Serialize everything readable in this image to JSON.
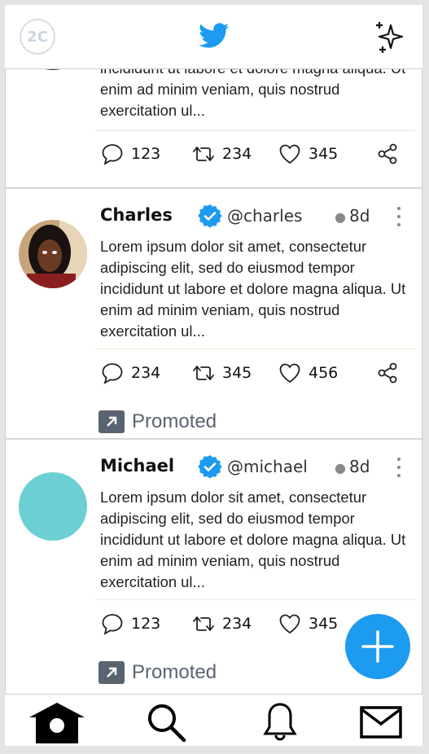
{
  "header": {
    "avatar_text": "2C",
    "logo_icon": "twitter-bird-icon",
    "sparkle_icon": "sparkle-icon"
  },
  "tweets": [
    {
      "body": "incididunt ut labore et dolore magna aliqua. Ut enim ad minim veniam, quis nostrud exercitation ul...",
      "replies": "123",
      "retweets": "234",
      "likes": "345"
    },
    {
      "name": "Charles",
      "handle": "@charles",
      "time": "8d",
      "body": "Lorem ipsum dolor sit amet, consectetur adipiscing elit, sed do eiusmod tempor incididunt ut labore et dolore magna aliqua. Ut enim ad minim veniam, quis nostrud exercitation ul...",
      "replies": "234",
      "retweets": "345",
      "likes": "456",
      "promoted": "Promoted"
    },
    {
      "name": "Michael",
      "handle": "@michael",
      "time": "8d",
      "body": "Lorem ipsum dolor sit amet, consectetur adipiscing elit, sed do eiusmod tempor incididunt ut labore et dolore magna aliqua. Ut enim ad minim veniam, quis nostrud exercitation ul...",
      "replies": "123",
      "retweets": "234",
      "likes": "345",
      "promoted": "Promoted"
    }
  ],
  "colors": {
    "accent": "#1d9bf0",
    "avatar_teal": "#6bcfd4",
    "promoted_gray": "#5a6470"
  },
  "nav": [
    "home-icon",
    "search-icon",
    "notifications-bell-icon",
    "messages-envelope-icon"
  ]
}
